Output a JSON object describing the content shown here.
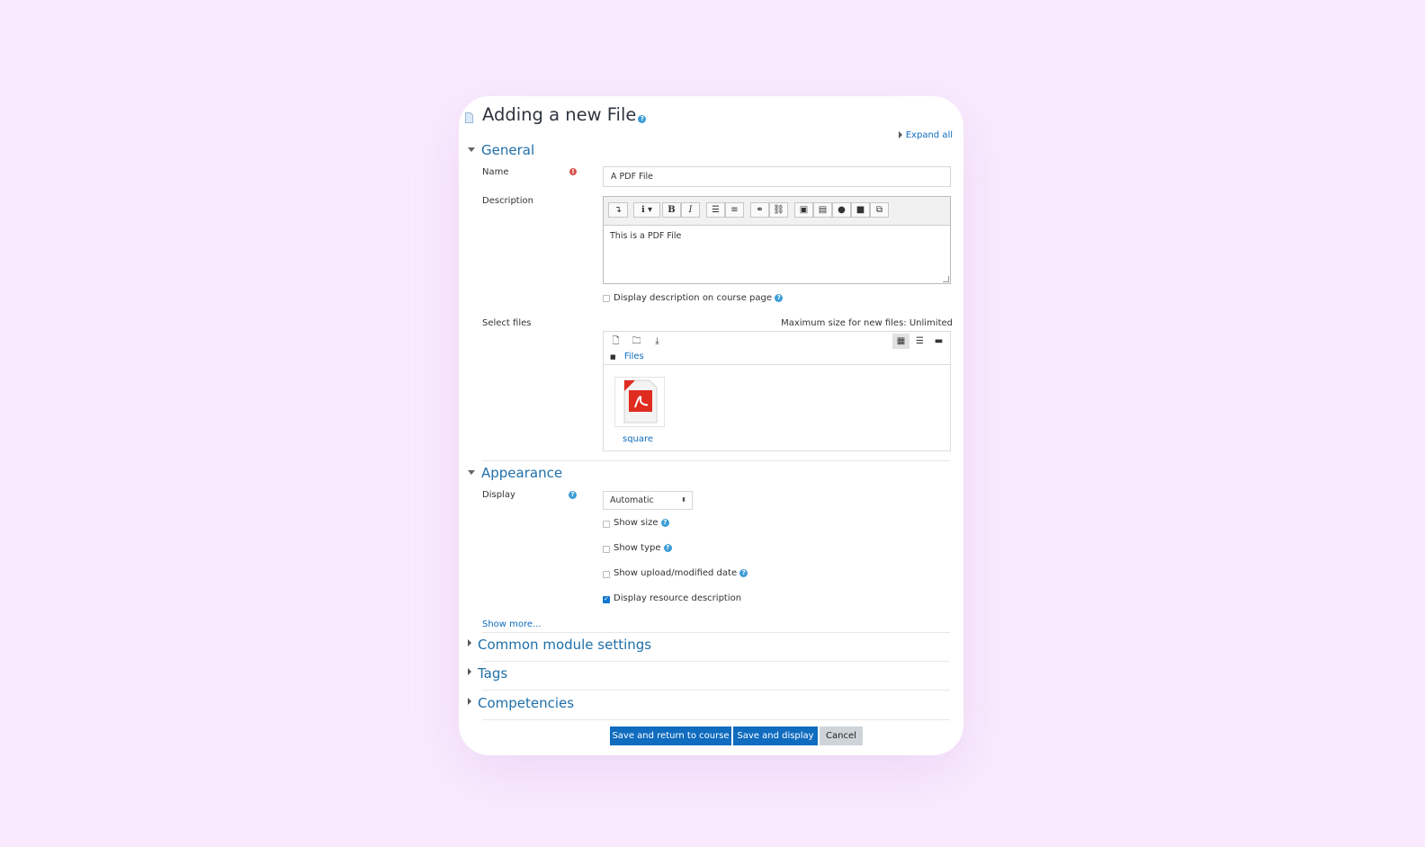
{
  "form": {
    "title": "Adding a new File",
    "expand_all": "Expand all"
  },
  "general": {
    "heading": "General",
    "name_label": "Name",
    "name_value": "A PDF File",
    "description_label": "Description",
    "description_text": "This is a PDF File",
    "display_description_label": "Display description on course page",
    "select_files_label": "Select files",
    "max_size": "Maximum size for new files: Unlimited",
    "files_folder": "Files",
    "file_name": "square"
  },
  "appearance": {
    "heading": "Appearance",
    "display_label": "Display",
    "display_value": "Automatic",
    "show_size_label": "Show size",
    "show_size_checked": false,
    "show_type_label": "Show type",
    "show_type_checked": false,
    "show_date_label": "Show upload/modified date",
    "show_date_checked": false,
    "display_resource_label": "Display resource description",
    "display_resource_checked": true,
    "show_more": "Show more..."
  },
  "sections": {
    "common_module": "Common module settings",
    "tags": "Tags",
    "competencies": "Competencies"
  },
  "buttons": {
    "save_return": "Save and return to course",
    "save_display": "Save and display",
    "cancel": "Cancel"
  },
  "colors": {
    "background": "#f9ebfd",
    "accent": "#0f6cbf",
    "heading": "#1f6fa8",
    "required": "#d9534f",
    "pdf_red": "#e02b20"
  }
}
